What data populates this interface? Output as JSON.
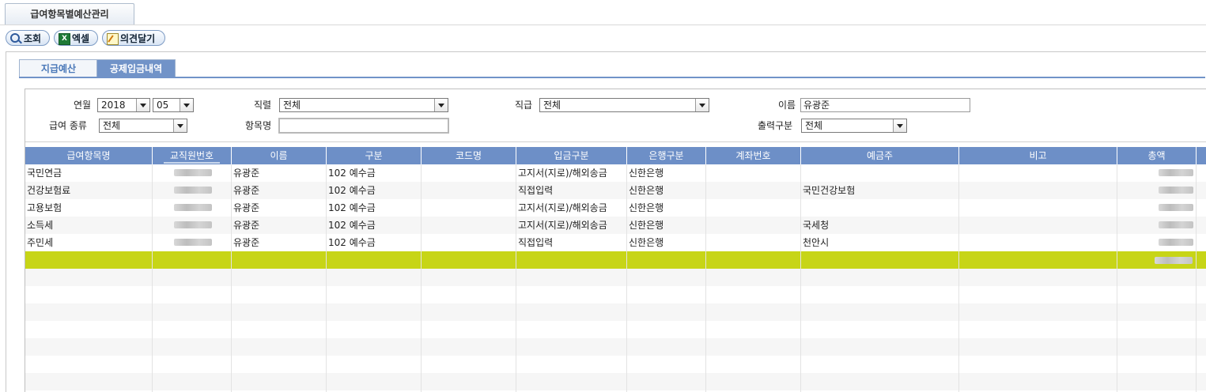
{
  "window": {
    "tab_title": "급여항목별예산관리"
  },
  "toolbar": {
    "search_label": "조회",
    "excel_label": "엑셀",
    "memo_label": "의견달기"
  },
  "subtabs": {
    "tab1": "지급예산",
    "tab2": "공제입금내역"
  },
  "filters": {
    "year_month_label": "연월",
    "year": "2018",
    "month": "05",
    "job_type_label": "직렬",
    "job_type": "전체",
    "grade_label": "직급",
    "grade": "전체",
    "name_label": "이름",
    "name": "유광준",
    "pay_kind_label": "급여 종류",
    "pay_kind": "전체",
    "item_name_label": "항목명",
    "item_name": "",
    "output_type_label": "출력구분",
    "output_type": "전체"
  },
  "grid": {
    "columns": [
      "급여항목명",
      "교직원번호",
      "이름",
      "구분",
      "코드명",
      "입금구분",
      "은행구분",
      "계좌번호",
      "예금주",
      "비고",
      "총액"
    ],
    "rows": [
      [
        "국민연금",
        "",
        "유광준",
        "102 예수금",
        "",
        "고지서(지로)/해외송금",
        "신한은행",
        "",
        "",
        "",
        ""
      ],
      [
        "건강보험료",
        "",
        "유광준",
        "102 예수금",
        "",
        "직접입력",
        "신한은행",
        "",
        "국민건강보험",
        "",
        ""
      ],
      [
        "고용보험",
        "",
        "유광준",
        "102 예수금",
        "",
        "고지서(지로)/해외송금",
        "신한은행",
        "",
        "",
        "",
        ""
      ],
      [
        "소득세",
        "",
        "유광준",
        "102 예수금",
        "",
        "고지서(지로)/해외송금",
        "신한은행",
        "",
        "국세청",
        "",
        ""
      ],
      [
        "주민세",
        "",
        "유광준",
        "102 예수금",
        "",
        "직접입력",
        "신한은행",
        "",
        "천안시",
        "",
        ""
      ]
    ],
    "total_row_color": "#c7d517",
    "header_color": "#6d8fc7"
  }
}
